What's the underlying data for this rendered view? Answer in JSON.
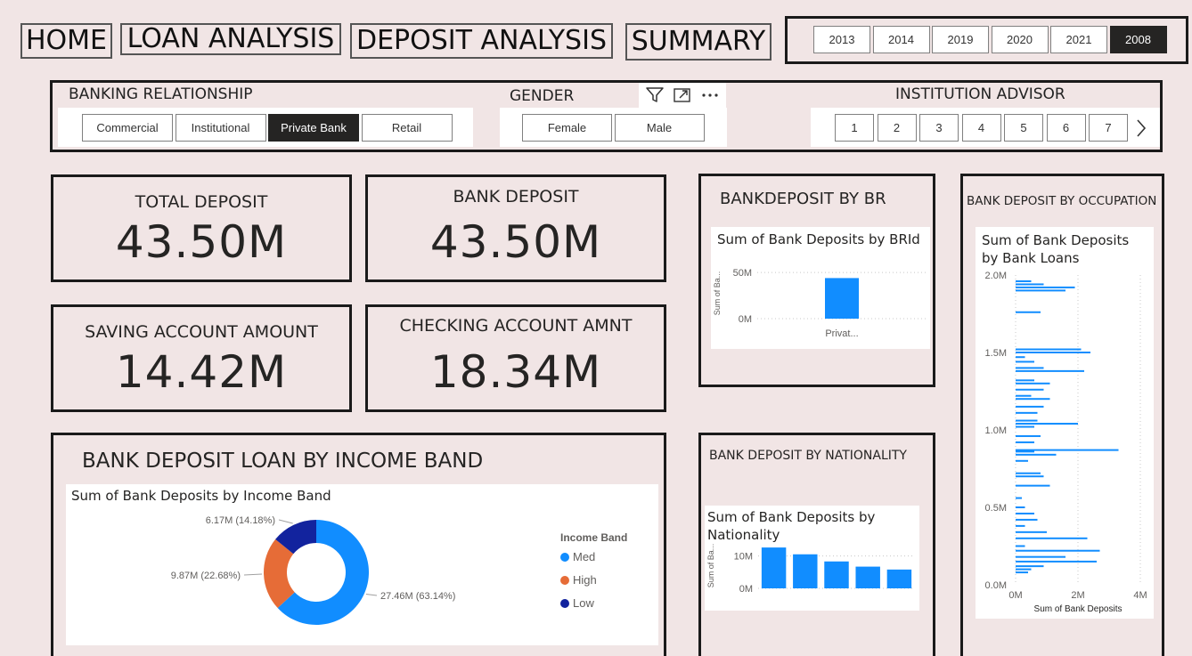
{
  "nav": {
    "home": "HOME",
    "loan_analysis": "LOAN ANALYSIS",
    "deposit_analysis": "DEPOSIT ANALYSIS",
    "summary": "SUMMARY"
  },
  "years": {
    "items": [
      "2013",
      "2014",
      "2019",
      "2020",
      "2021",
      "2008"
    ],
    "selected": "2008"
  },
  "slicers": {
    "banking_relationship": {
      "title": "BANKING RELATIONSHIP",
      "items": [
        "Commercial",
        "Institutional",
        "Private Bank",
        "Retail"
      ],
      "selected": "Private Bank"
    },
    "gender": {
      "title": "GENDER",
      "items": [
        "Female",
        "Male"
      ]
    },
    "institution_advisor": {
      "title": "INSTITUTION ADVISOR",
      "items": [
        "1",
        "2",
        "3",
        "4",
        "5",
        "6",
        "7"
      ]
    },
    "header_icons": [
      "filter-icon",
      "focus-mode-icon",
      "more-options-icon"
    ]
  },
  "kpis": {
    "total_deposit": {
      "label": "TOTAL DEPOSIT",
      "value": "43.50M"
    },
    "bank_deposit": {
      "label": "BANK DEPOSIT",
      "value": "43.50M"
    },
    "saving_account": {
      "label": "SAVING ACCOUNT AMOUNT",
      "value": "14.42M"
    },
    "checking_account": {
      "label": "CHECKING ACCOUNT AMNT",
      "value": "18.34M"
    }
  },
  "sections": {
    "by_br": "BANKDEPOSIT BY BR",
    "by_occupation": "BANK DEPOSIT BY OCCUPATION",
    "by_nationality": "BANK DEPOSIT BY NATIONALITY",
    "by_income_band": "BANK DEPOSIT LOAN BY INCOME BAND"
  },
  "chart_data": [
    {
      "id": "br",
      "type": "bar",
      "title": "Sum of Bank Deposits by BRId",
      "ylabel": "Sum of Ba...",
      "categories": [
        "Privat..."
      ],
      "values": [
        44
      ],
      "ylim": [
        0,
        55
      ],
      "yticks": [
        {
          "value": 0,
          "label": "0M"
        },
        {
          "value": 50,
          "label": "50M"
        }
      ],
      "grid": true,
      "color": "#118dff"
    },
    {
      "id": "nationality",
      "type": "bar",
      "title": "Sum of Bank Deposits by Nationality",
      "ylabel": "Sum of Ba...",
      "values": [
        12.6,
        10.5,
        8.3,
        6.7,
        5.8
      ],
      "ylim": [
        0,
        14
      ],
      "yticks": [
        {
          "value": 0,
          "label": "0M"
        },
        {
          "value": 10,
          "label": "10M"
        }
      ],
      "grid": true,
      "color": "#118dff"
    },
    {
      "id": "income_band",
      "type": "pie",
      "title": "Sum of Bank Deposits by Income Band",
      "legend_title": "Income Band",
      "slices": [
        {
          "name": "Med",
          "value": 27.46,
          "label": "27.46M (63.14%)",
          "color": "#118dff"
        },
        {
          "name": "High",
          "value": 9.87,
          "label": "9.87M (22.68%)",
          "color": "#e66c37"
        },
        {
          "name": "Low",
          "value": 6.17,
          "label": "6.17M (14.18%)",
          "color": "#12239e"
        }
      ],
      "legend_placement": "right"
    },
    {
      "id": "occupation",
      "type": "bar",
      "orientation": "horizontal",
      "title": "Sum of Bank Deposits by Bank Loans",
      "xlabel": "Sum of Bank Deposits",
      "xlim": [
        0,
        4
      ],
      "ylim": [
        0,
        2
      ],
      "xticks": [
        {
          "value": 0,
          "label": "0M"
        },
        {
          "value": 2,
          "label": "2M"
        },
        {
          "value": 4,
          "label": "4M"
        }
      ],
      "yticks": [
        {
          "value": 0,
          "label": "0.0M"
        },
        {
          "value": 0.5,
          "label": "0.5M"
        },
        {
          "value": 1,
          "label": "1.0M"
        },
        {
          "value": 1.5,
          "label": "1.5M"
        },
        {
          "value": 2,
          "label": "2.0M"
        }
      ],
      "color": "#118dff",
      "points": [
        [
          1.96,
          0.5
        ],
        [
          1.94,
          0.9
        ],
        [
          1.92,
          1.9
        ],
        [
          1.9,
          1.6
        ],
        [
          1.76,
          0.8
        ],
        [
          1.52,
          2.1
        ],
        [
          1.5,
          2.4
        ],
        [
          1.47,
          0.3
        ],
        [
          1.44,
          0.6
        ],
        [
          1.4,
          0.9
        ],
        [
          1.38,
          2.2
        ],
        [
          1.32,
          0.6
        ],
        [
          1.3,
          1.1
        ],
        [
          1.26,
          0.9
        ],
        [
          1.22,
          0.5
        ],
        [
          1.2,
          1.1
        ],
        [
          1.15,
          0.9
        ],
        [
          1.11,
          0.7
        ],
        [
          1.06,
          0.7
        ],
        [
          1.04,
          2.0
        ],
        [
          1.02,
          0.6
        ],
        [
          0.96,
          0.8
        ],
        [
          0.92,
          0.6
        ],
        [
          0.87,
          3.3
        ],
        [
          0.86,
          0.6
        ],
        [
          0.84,
          1.3
        ],
        [
          0.8,
          0.4
        ],
        [
          0.72,
          0.8
        ],
        [
          0.7,
          0.9
        ],
        [
          0.64,
          1.1
        ],
        [
          0.56,
          0.2
        ],
        [
          0.5,
          0.3
        ],
        [
          0.46,
          0.6
        ],
        [
          0.42,
          0.7
        ],
        [
          0.38,
          0.3
        ],
        [
          0.34,
          1.0
        ],
        [
          0.3,
          2.3
        ],
        [
          0.25,
          0.3
        ],
        [
          0.22,
          2.7
        ],
        [
          0.18,
          1.6
        ],
        [
          0.15,
          2.6
        ],
        [
          0.12,
          0.9
        ],
        [
          0.1,
          0.5
        ],
        [
          0.08,
          0.4
        ]
      ]
    }
  ]
}
